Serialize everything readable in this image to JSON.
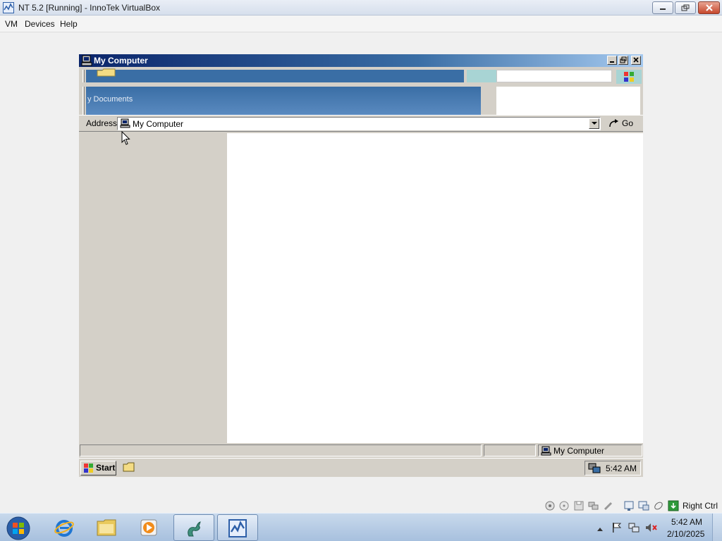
{
  "host_window": {
    "title": "NT 5.2 [Running] - InnoTek VirtualBox",
    "menu": [
      "VM",
      "Devices",
      "Help"
    ]
  },
  "guest_window": {
    "title": "My Computer",
    "toolbar_band_label": "y Documents",
    "address_label": "Address",
    "address_value": "My Computer",
    "go_label": "Go",
    "status_location": "My Computer"
  },
  "guest_taskbar": {
    "start_label": "Start",
    "clock": "5:42 AM"
  },
  "vbox_status": {
    "host_key": "Right Ctrl"
  },
  "host_taskbar": {
    "clock_time": "5:42 AM",
    "clock_date": "2/10/2025"
  }
}
